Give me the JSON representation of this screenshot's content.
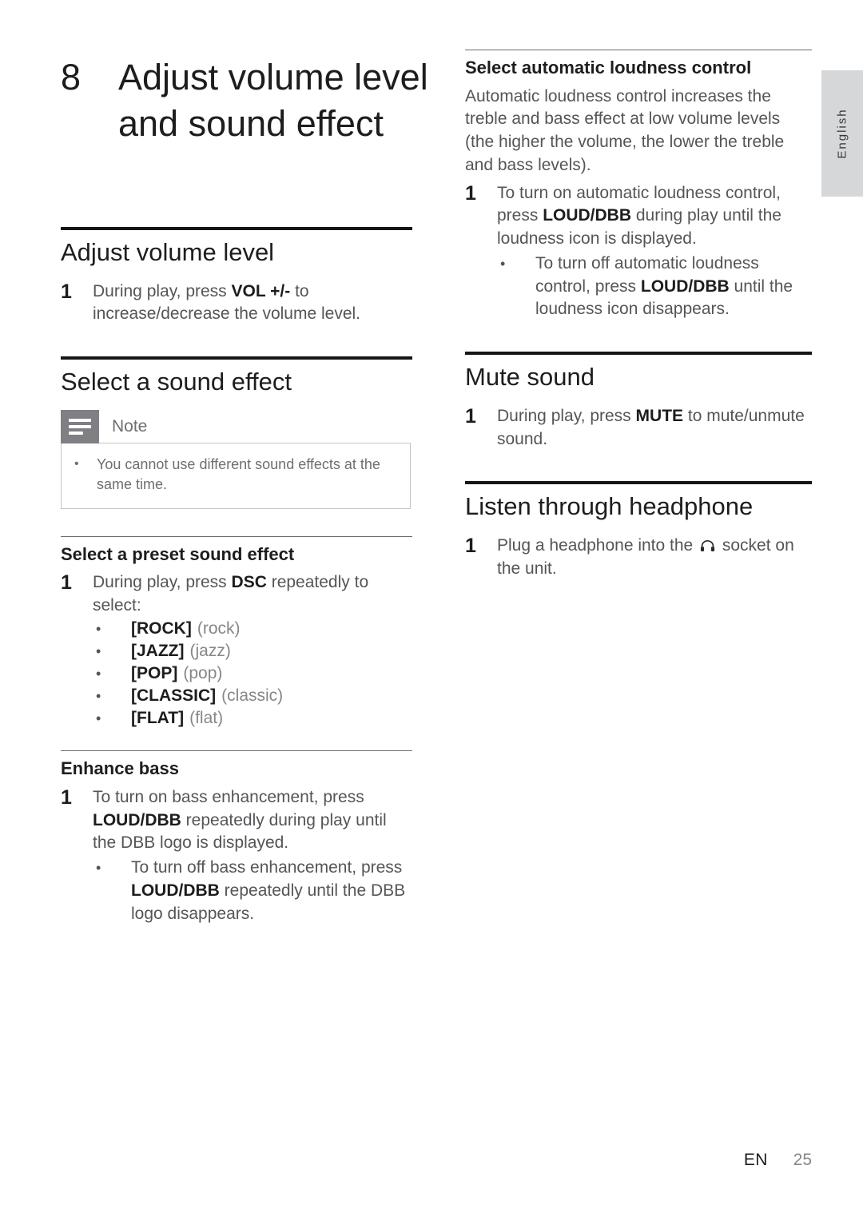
{
  "language_tab": {
    "label": "English"
  },
  "chapter": {
    "number": "8",
    "title": "Adjust volume level and sound effect"
  },
  "left_column": {
    "section_volume": {
      "title": "Adjust volume level",
      "step_number": "1",
      "step_text_pre": "During play, press ",
      "step_key": "VOL +/-",
      "step_text_post": " to increase/decrease the volume level."
    },
    "section_sound_effect": {
      "title": "Select a sound effect",
      "note": {
        "label": "Note",
        "bullet": "You cannot use different sound effects at the same time.",
        "bullet_marker": "•",
        "icon": "note-lines-icon"
      },
      "subsection_preset": {
        "title": "Select a preset sound effect",
        "step_number": "1",
        "step_text_pre": "During play, press ",
        "step_key": "DSC",
        "step_text_post": " repeatedly to select:",
        "presets": [
          {
            "marker": "•",
            "code": "[ROCK]",
            "desc": "(rock)"
          },
          {
            "marker": "•",
            "code": "[JAZZ]",
            "desc": "(jazz)"
          },
          {
            "marker": "•",
            "code": "[POP]",
            "desc": "(pop)"
          },
          {
            "marker": "•",
            "code": "[CLASSIC]",
            "desc": "(classic)"
          },
          {
            "marker": "•",
            "code": "[FLAT]",
            "desc": "(flat)"
          }
        ]
      },
      "subsection_bass": {
        "title": "Enhance bass",
        "step_number": "1",
        "step_text_pre": "To turn on bass enhancement, press ",
        "step_key": "LOUD/DBB",
        "step_text_post": " repeatedly during play until the DBB logo is displayed.",
        "sub_bullet": {
          "marker": "•",
          "text_pre": "To turn off bass enhancement, press ",
          "key": "LOUD/DBB",
          "text_post": " repeatedly until the DBB logo disappears."
        }
      }
    }
  },
  "right_column": {
    "subsection_loudness": {
      "title": "Select automatic loudness control",
      "intro": "Automatic loudness control increases the treble and bass effect at low volume levels (the higher the volume, the lower the treble and bass levels).",
      "step_number": "1",
      "step_text_pre": "To turn on automatic loudness control, press ",
      "step_key": "LOUD/DBB",
      "step_text_post": " during play until the loudness icon is displayed.",
      "sub_bullet": {
        "marker": "•",
        "text_pre": "To turn off automatic loudness control, press ",
        "key": "LOUD/DBB",
        "text_post": " until the loudness icon disappears."
      }
    },
    "section_mute": {
      "title": "Mute sound",
      "step_number": "1",
      "step_text_pre": "During play, press ",
      "step_key": "MUTE",
      "step_text_post": " to mute/unmute sound."
    },
    "section_headphone": {
      "title": "Listen through headphone",
      "step_number": "1",
      "step_text_pre": "Plug a headphone into the ",
      "step_icon": "headphone-icon",
      "step_text_post": " socket on the unit."
    }
  },
  "footer": {
    "language_code": "EN",
    "page_number": "25"
  },
  "colors": {
    "heading": "#1d1d1f",
    "body": "#555559",
    "muted": "#86868b",
    "rule_major": "#161617",
    "rule_minor": "#6c6c70",
    "note_icon_bg": "#7f7f84",
    "note_border": "#c4c4c8",
    "lang_tab_bg": "#d6d7d9"
  }
}
